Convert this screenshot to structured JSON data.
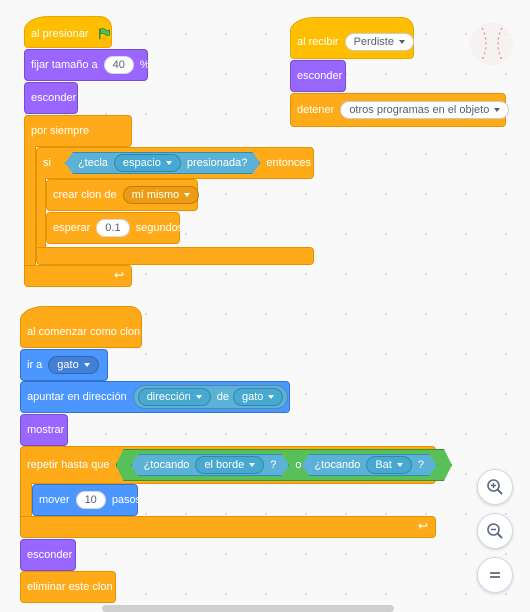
{
  "script1": {
    "when_flag": "al presionar",
    "set_size": "fijar tamaño a",
    "size_value": "40",
    "size_unit": "%",
    "hide": "esconder",
    "forever": "por siempre",
    "if": "si",
    "key_pressed_pre": "¿tecla",
    "key_value": "espacio",
    "key_pressed_post": "presionada?",
    "then": "entonces",
    "create_clone": "crear clon de",
    "clone_target": "mí mismo",
    "wait": "esperar",
    "wait_value": "0.1",
    "seconds": "segundos"
  },
  "script2": {
    "when_receive": "al recibir",
    "message": "Perdiste",
    "hide": "esconder",
    "stop": "detener",
    "stop_option": "otros programas en el objeto"
  },
  "script3": {
    "when_clone": "al comenzar como clon",
    "goto": "ir a",
    "goto_target": "gato",
    "point_towards": "apuntar en dirección",
    "direction_attr": "dirección",
    "of": "de",
    "of_target": "gato",
    "show": "mostrar",
    "repeat_until": "repetir hasta que",
    "touching1": "¿tocando",
    "touching1_target": "el borde",
    "q1": "?",
    "or": "o",
    "touching2": "¿tocando",
    "touching2_target": "Bat",
    "q2": "?",
    "move": "mover",
    "move_value": "10",
    "steps": "pasos",
    "hide": "esconder",
    "delete_clone": "eliminar este clon"
  },
  "zoom": {
    "zoom_in_icon": "zoom-in-icon",
    "zoom_out_icon": "zoom-out-icon",
    "reset_icon": "equals-icon"
  },
  "colors": {
    "events": "#ffbf00",
    "control": "#ffab19",
    "looks": "#9966ff",
    "motion": "#4c97ff",
    "sensing": "#5cb1d6",
    "operators": "#59c059"
  }
}
